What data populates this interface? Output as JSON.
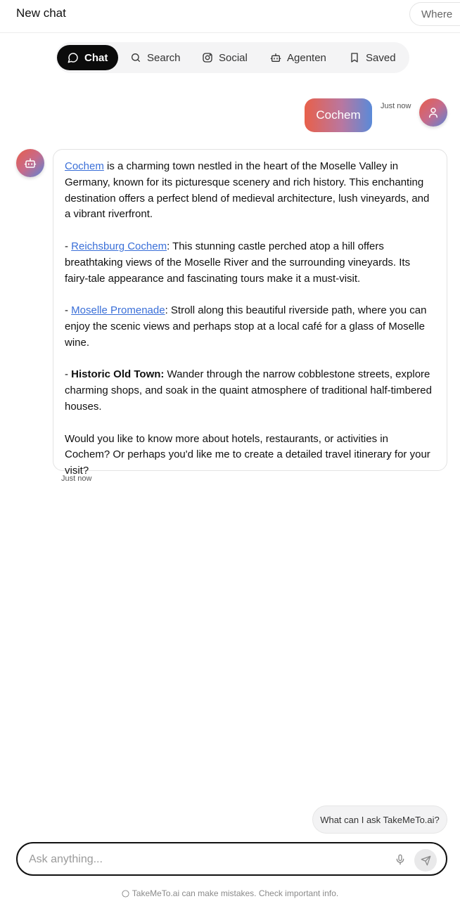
{
  "header": {
    "title": "New chat",
    "location_button": "Where"
  },
  "tabs": [
    {
      "label": "Chat",
      "icon": "chat-bubble-icon",
      "active": true
    },
    {
      "label": "Search",
      "icon": "search-icon",
      "active": false
    },
    {
      "label": "Social",
      "icon": "instagram-icon",
      "active": false
    },
    {
      "label": "Agenten",
      "icon": "robot-icon",
      "active": false
    },
    {
      "label": "Saved",
      "icon": "bookmark-icon",
      "active": false
    }
  ],
  "messages": {
    "user": {
      "text": "Cochem",
      "time": "Just now"
    },
    "bot": {
      "time": "Just now",
      "intro_link": "Cochem",
      "intro_text": " is a charming town nestled in the heart of the Moselle Valley in Germany, known for its picturesque scenery and rich history. This enchanting destination offers a perfect blend of medieval architecture, lush vineyards, and a vibrant riverfront.",
      "item1_prefix": "- ",
      "item1_link": "Reichsburg Cochem",
      "item1_text": ": This stunning castle perched atop a hill offers breathtaking views of the Moselle River and the surrounding vineyards. Its fairy-tale appearance and fascinating tours make it a must-visit.",
      "item2_prefix": "- ",
      "item2_link": "Moselle Promenade",
      "item2_text": ": Stroll along this beautiful riverside path, where you can enjoy the scenic views and perhaps stop at a local café for a glass of Moselle wine.",
      "item3_prefix": "- ",
      "item3_bold": "Historic Old Town:",
      "item3_text": " Wander through the narrow cobblestone streets, explore charming shops, and soak in the quaint atmosphere of traditional half-timbered houses.",
      "outro": "Would you like to know more about hotels, restaurants, or activities in Cochem? Or perhaps you'd like me to create a detailed travel itinerary for your visit?"
    }
  },
  "suggestion": "What can I ask TakeMeTo.ai?",
  "input": {
    "placeholder": "Ask anything...",
    "value": ""
  },
  "footer": {
    "disclaimer": "TakeMeTo.ai can make mistakes. Check important info."
  },
  "colors": {
    "accent_start": "#e8604a",
    "accent_end": "#5a8ad8",
    "link": "#3a6fd8",
    "active_tab": "#0b0b0b"
  }
}
